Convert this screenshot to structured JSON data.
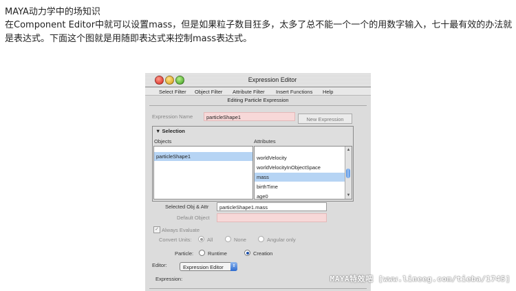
{
  "article": {
    "title": "MAYA动力学中的场知识",
    "paragraph": "在Component Editor中就可以设置mass，但是如果粒子数目狂多，太多了总不能一个一个的用数字输入，七十最有效的办法就是表达式。下面这个图就是用随即表达式来控制mass表达式。"
  },
  "window": {
    "title": "Expression Editor",
    "menus": [
      "Select Filter",
      "Object Filter",
      "Attribute Filter",
      "Insert Functions",
      "Help"
    ],
    "editing_label": "Editing Particle Expression"
  },
  "expression_name": {
    "label": "Expression Name",
    "value": "particleShape1",
    "new_button": "New Expression"
  },
  "selection": {
    "header": "Selection",
    "objects_label": "Objects",
    "attributes_label": "Attributes",
    "objects": [
      "particleShape1"
    ],
    "selected_object": "particleShape1",
    "attributes": [
      "worldVelocity",
      "worldVelocityInObjectSpace",
      "mass",
      "birthTime",
      "age0"
    ],
    "selected_attribute": "mass"
  },
  "selected_obj_attr": {
    "label": "Selected Obj & Attr",
    "value": "particleShape1.mass"
  },
  "default_object": {
    "label": "Default Object",
    "value": ""
  },
  "always_evaluate": {
    "label": "Always Evaluate",
    "checked": true
  },
  "convert_units": {
    "label": "Convert Units:",
    "options": [
      "All",
      "None",
      "Angular only"
    ],
    "selected": "All"
  },
  "particle": {
    "label": "Particle:",
    "options": [
      "Runtime",
      "Creation"
    ],
    "selected": "Creation"
  },
  "editor": {
    "label": "Editor:",
    "value": "Expression Editor"
  },
  "expression": {
    "label": "Expression:"
  },
  "watermark": "MAYA特效吧 [www.lineeg.com/tieba/1745]",
  "colors": {
    "selection_highlight": "#b6d4f4",
    "pink_field": "#f7d8d8",
    "aqua_blue": "#2e6cd0"
  }
}
